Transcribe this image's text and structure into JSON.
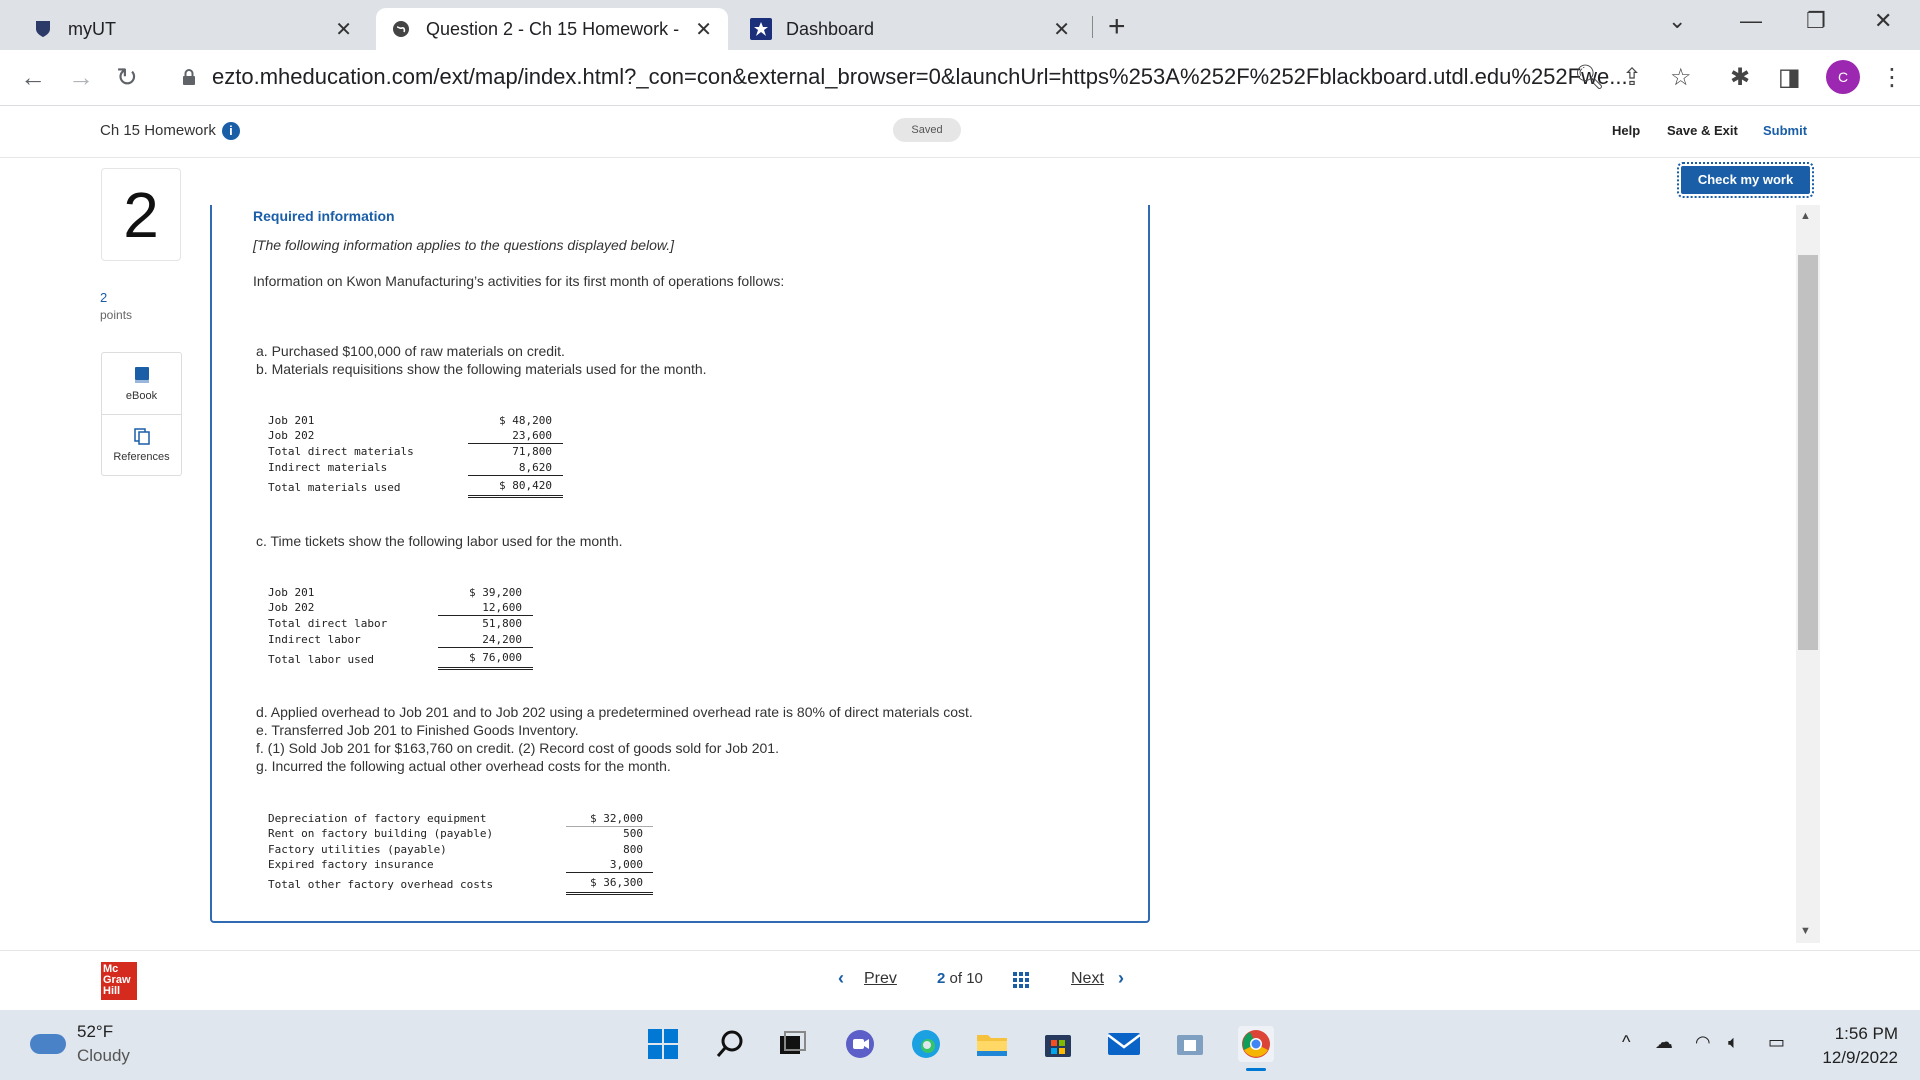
{
  "browser": {
    "tabs": [
      {
        "title": "myUT"
      },
      {
        "title": "Question 2 - Ch 15 Homework -"
      },
      {
        "title": "Dashboard"
      }
    ],
    "url": "ezto.mheducation.com/ext/map/index.html?_con=con&external_browser=0&launchUrl=https%253A%252F%252Fblackboard.utdl.edu%252Fwe...",
    "profile_initial": "C"
  },
  "header": {
    "assignment": "Ch 15 Homework",
    "saved": "Saved",
    "help": "Help",
    "save_exit": "Save & Exit",
    "submit": "Submit",
    "check_work": "Check my work"
  },
  "rail": {
    "question_number": "2",
    "points_value": "2",
    "points_label": "points",
    "ebook": "eBook",
    "references": "References"
  },
  "question": {
    "heading": "Required information",
    "subheading": "[The following information applies to the questions displayed below.]",
    "intro": "Information on Kwon Manufacturing’s activities for its first month of operations follows:",
    "a": "a. Purchased $100,000 of raw materials on credit.",
    "b": "b. Materials requisitions show the following materials used for the month.",
    "materials": [
      {
        "label": "Job 201",
        "value": "$ 48,200"
      },
      {
        "label": "Job 202",
        "value": "23,600"
      },
      {
        "label": "Total direct materials",
        "value": "71,800"
      },
      {
        "label": "Indirect materials",
        "value": "8,620"
      },
      {
        "label": "Total materials used",
        "value": "$ 80,420"
      }
    ],
    "c": "c. Time tickets show the following labor used for the month.",
    "labor": [
      {
        "label": "Job 201",
        "value": "$ 39,200"
      },
      {
        "label": "Job 202",
        "value": "12,600"
      },
      {
        "label": "Total direct labor",
        "value": "51,800"
      },
      {
        "label": "Indirect labor",
        "value": "24,200"
      },
      {
        "label": "Total labor used",
        "value": "$ 76,000"
      }
    ],
    "d": "d. Applied overhead to Job 201 and to Job 202 using a predetermined overhead rate is 80% of direct materials cost.",
    "e": "e. Transferred Job 201 to Finished Goods Inventory.",
    "f": "f. (1) Sold Job 201 for $163,760 on credit. (2) Record cost of goods sold for Job 201.",
    "g": "g. Incurred the following actual other overhead costs for the month.",
    "overhead": [
      {
        "label": "Depreciation of factory equipment",
        "value": "$ 32,000"
      },
      {
        "label": "Rent on factory building (payable)",
        "value": "500"
      },
      {
        "label": "Factory utilities (payable)",
        "value": "800"
      },
      {
        "label": "Expired factory insurance",
        "value": "3,000"
      },
      {
        "label": "Total other factory overhead costs",
        "value": "$ 36,300"
      }
    ]
  },
  "footer": {
    "logo_line1": "Mc",
    "logo_line2": "Graw",
    "logo_line3": "Hill",
    "prev": "Prev",
    "current": "2",
    "of": "of",
    "total": "10",
    "next": "Next"
  },
  "taskbar": {
    "temp": "52°F",
    "weather": "Cloudy",
    "time": "1:56 PM",
    "date": "12/9/2022"
  }
}
